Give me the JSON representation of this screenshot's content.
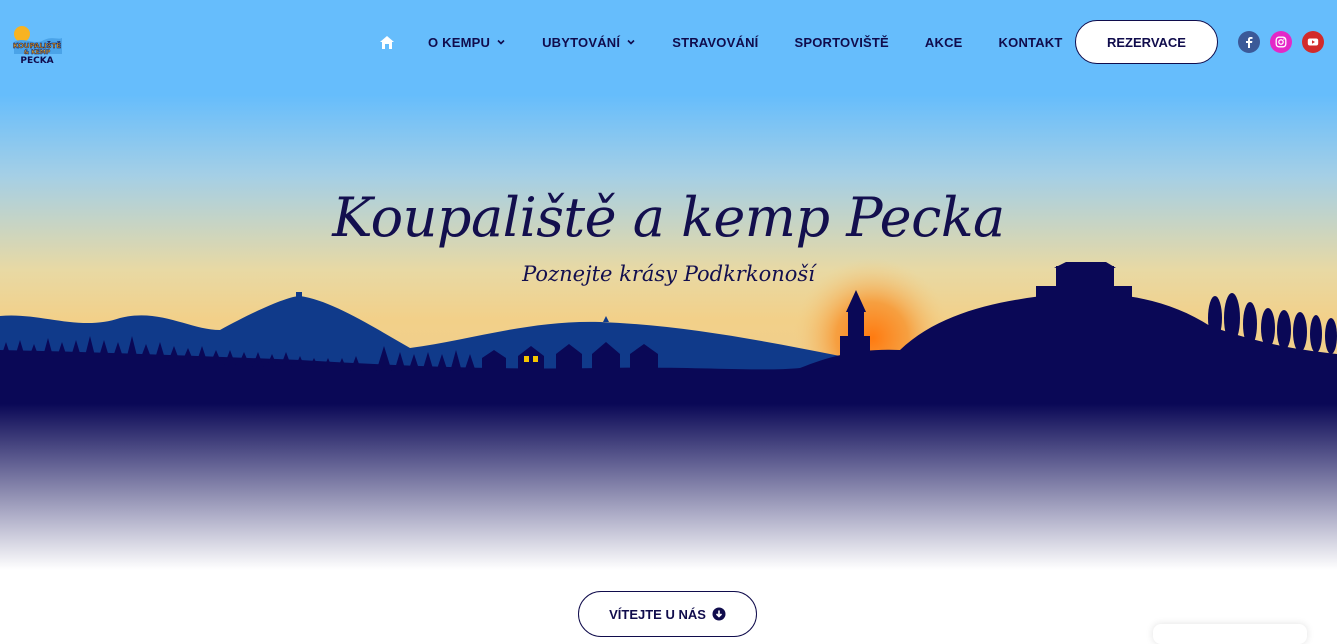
{
  "header": {
    "logo_text": [
      "KOUPALIŠTĚ",
      "& KEMP",
      "PECKA"
    ],
    "nav": [
      {
        "label": "O KEMPU",
        "has_dropdown": true
      },
      {
        "label": "UBYTOVÁNÍ",
        "has_dropdown": true
      },
      {
        "label": "STRAVOVÁNÍ",
        "has_dropdown": false
      },
      {
        "label": "SPORTOVIŠTĚ",
        "has_dropdown": false
      },
      {
        "label": "AKCE",
        "has_dropdown": false
      },
      {
        "label": "KONTAKT",
        "has_dropdown": false
      }
    ],
    "reserve_label": "REZERVACE",
    "socials": [
      {
        "icon": "facebook-icon",
        "color": "#3b5998"
      },
      {
        "icon": "instagram-icon",
        "color": "#e429c7"
      },
      {
        "icon": "youtube-icon",
        "color": "#d22a2a"
      }
    ]
  },
  "hero": {
    "title": "Koupaliště a kemp Pecka",
    "subtitle": "Poznejte krásy Podkrkonoší"
  },
  "cta": {
    "label": "VÍTEJTE U NÁS"
  },
  "colors": {
    "navy": "#100c4c",
    "sky": "#66bdfc",
    "sunset": "#f2d089",
    "hills": "#0a0856"
  }
}
